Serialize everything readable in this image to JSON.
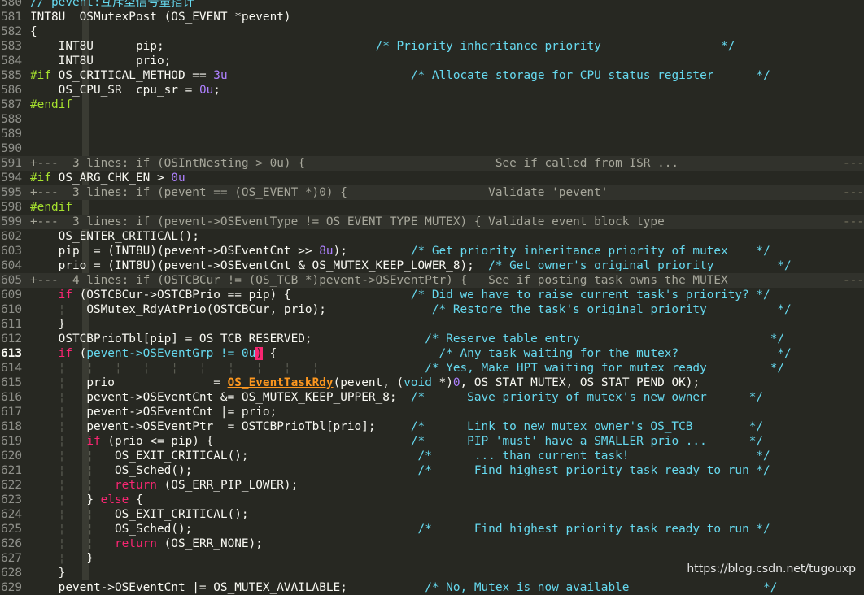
{
  "editor": {
    "lines": [
      {
        "n": "580",
        "parts": [
          {
            "t": "// pevent:互斥型信号量指针",
            "c": "cm"
          }
        ]
      },
      {
        "n": "581",
        "parts": [
          {
            "t": "INT8U  OSMutexPost (OS_EVENT *pevent)"
          }
        ]
      },
      {
        "n": "582",
        "parts": [
          {
            "t": "{"
          }
        ]
      },
      {
        "n": "583",
        "parts": [
          {
            "t": "    INT8U      pip;                              "
          },
          {
            "t": "/* Priority inheritance priority                 */",
            "c": "cm"
          }
        ]
      },
      {
        "n": "584",
        "parts": [
          {
            "t": "    INT8U      prio;"
          }
        ]
      },
      {
        "n": "585",
        "parts": [
          {
            "t": "#if",
            "c": "pp"
          },
          {
            "t": " OS_CRITICAL_METHOD == "
          },
          {
            "t": "3u",
            "c": "num"
          },
          {
            "t": "                          "
          },
          {
            "t": "/* Allocate storage for CPU status register      */",
            "c": "cm"
          }
        ]
      },
      {
        "n": "586",
        "parts": [
          {
            "t": "    OS_CPU_SR  cpu_sr = "
          },
          {
            "t": "0u",
            "c": "num"
          },
          {
            "t": ";"
          }
        ]
      },
      {
        "n": "587",
        "parts": [
          {
            "t": "#endif",
            "c": "pp"
          }
        ]
      },
      {
        "n": "588",
        "parts": []
      },
      {
        "n": "589",
        "parts": []
      },
      {
        "n": "590",
        "parts": []
      },
      {
        "n": "591",
        "fold": true,
        "parts": [
          {
            "t": "+---  3 lines: if (OSIntNesting > 0u) {                           See if called from ISR ..."
          }
        ]
      },
      {
        "n": "594",
        "parts": [
          {
            "t": "#if",
            "c": "pp"
          },
          {
            "t": " OS_ARG_CHK_EN > "
          },
          {
            "t": "0u",
            "c": "num"
          }
        ]
      },
      {
        "n": "595",
        "fold": true,
        "parts": [
          {
            "t": "+---  3 lines: if (pevent == (OS_EVENT *)0) {                    Validate 'pevent'"
          }
        ]
      },
      {
        "n": "598",
        "parts": [
          {
            "t": "#endif",
            "c": "pp"
          }
        ]
      },
      {
        "n": "599",
        "fold": true,
        "parts": [
          {
            "t": "+---  3 lines: if (pevent->OSEventType != OS_EVENT_TYPE_MUTEX) { Validate event block type"
          }
        ]
      },
      {
        "n": "602",
        "parts": [
          {
            "t": "    OS_ENTER_CRITICAL();"
          }
        ]
      },
      {
        "n": "603",
        "parts": [
          {
            "t": "    pip  = (INT8U)(pevent->OSEventCnt >> "
          },
          {
            "t": "8u",
            "c": "num"
          },
          {
            "t": ");         "
          },
          {
            "t": "/* Get priority inheritance priority of mutex    */",
            "c": "cm"
          }
        ]
      },
      {
        "n": "604",
        "parts": [
          {
            "t": "    prio = (INT8U)(pevent->OSEventCnt & OS_MUTEX_KEEP_LOWER_8);  "
          },
          {
            "t": "/* Get owner's original priority         */",
            "c": "cm"
          }
        ]
      },
      {
        "n": "605",
        "fold": true,
        "parts": [
          {
            "t": "+---  4 lines: if (OSTCBCur != (OS_TCB *)pevent->OSEventPtr) {   See if posting task owns the MUTEX"
          }
        ]
      },
      {
        "n": "609",
        "parts": [
          {
            "t": "    "
          },
          {
            "t": "if",
            "c": "kw"
          },
          {
            "t": " (OSTCBCur->OSTCBPrio == pip) {                 "
          },
          {
            "t": "/* Did we have to raise current task's priority? */",
            "c": "cm"
          }
        ]
      },
      {
        "n": "610",
        "parts": [
          {
            "t": "    "
          },
          {
            "t": "¦",
            "c": "guide"
          },
          {
            "t": "   OSMutex_RdyAtPrio(OSTCBCur, prio);               "
          },
          {
            "t": "/* Restore the task's original priority          */",
            "c": "cm"
          }
        ]
      },
      {
        "n": "611",
        "parts": [
          {
            "t": "    }"
          }
        ]
      },
      {
        "n": "612",
        "parts": [
          {
            "t": "    OSTCBPrioTbl[pip] = OS_TCB_RESERVED;                "
          },
          {
            "t": "/* Reserve table entry                           */",
            "c": "cm"
          }
        ]
      },
      {
        "n": "613",
        "cur": true,
        "parts": [
          {
            "t": "    "
          },
          {
            "t": "if",
            "c": "kw"
          },
          {
            "t": " ("
          },
          {
            "t": "pevent->OSEventGrp != 0u",
            "c": "hl"
          },
          {
            "t": ")",
            "c": "br"
          },
          {
            "t": " {                       "
          },
          {
            "t": "/* Any task waiting for the mutex?              */",
            "c": "cm"
          }
        ]
      },
      {
        "n": "614",
        "parts": [
          {
            "t": "    "
          },
          {
            "t": "¦   ¦   ¦   ¦   ¦   ¦   ¦   ¦   ¦   ¦",
            "c": "guide"
          },
          {
            "t": "               "
          },
          {
            "t": "/* Yes, Make HPT waiting for mutex ready         */",
            "c": "cm"
          }
        ]
      },
      {
        "n": "615",
        "parts": [
          {
            "t": "    "
          },
          {
            "t": "¦",
            "c": "guide"
          },
          {
            "t": "   prio              = "
          },
          {
            "t": "OS_EventTaskRdy",
            "c": "fn"
          },
          {
            "t": "(pevent, ("
          },
          {
            "t": "void",
            "c": "cm"
          },
          {
            "t": " *)"
          },
          {
            "t": "0",
            "c": "num"
          },
          {
            "t": ", OS_STAT_MUTEX, OS_STAT_PEND_OK);"
          }
        ]
      },
      {
        "n": "616",
        "parts": [
          {
            "t": "    "
          },
          {
            "t": "¦",
            "c": "guide"
          },
          {
            "t": "   pevent->OSEventCnt &= OS_MUTEX_KEEP_UPPER_8;  "
          },
          {
            "t": "/*      Save priority of mutex's new owner      */",
            "c": "cm"
          }
        ]
      },
      {
        "n": "617",
        "parts": [
          {
            "t": "    "
          },
          {
            "t": "¦",
            "c": "guide"
          },
          {
            "t": "   pevent->OSEventCnt |= prio;"
          }
        ]
      },
      {
        "n": "618",
        "parts": [
          {
            "t": "    "
          },
          {
            "t": "¦",
            "c": "guide"
          },
          {
            "t": "   pevent->OSEventPtr  = OSTCBPrioTbl[prio];     "
          },
          {
            "t": "/*      Link to new mutex owner's OS_TCB        */",
            "c": "cm"
          }
        ]
      },
      {
        "n": "619",
        "parts": [
          {
            "t": "    "
          },
          {
            "t": "¦",
            "c": "guide"
          },
          {
            "t": "   "
          },
          {
            "t": "if",
            "c": "kw"
          },
          {
            "t": " (prio <= pip) {                            "
          },
          {
            "t": "/*      PIP 'must' have a SMALLER prio ...      */",
            "c": "cm"
          }
        ]
      },
      {
        "n": "620",
        "parts": [
          {
            "t": "    "
          },
          {
            "t": "¦   ¦",
            "c": "guide"
          },
          {
            "t": "   OS_EXIT_CRITICAL();                        "
          },
          {
            "t": "/*      ... than current task!                  */",
            "c": "cm"
          }
        ]
      },
      {
        "n": "621",
        "parts": [
          {
            "t": "    "
          },
          {
            "t": "¦   ¦",
            "c": "guide"
          },
          {
            "t": "   OS_Sched();                                "
          },
          {
            "t": "/*      Find highest priority task ready to run */",
            "c": "cm"
          }
        ]
      },
      {
        "n": "622",
        "parts": [
          {
            "t": "    "
          },
          {
            "t": "¦   ¦",
            "c": "guide"
          },
          {
            "t": "   "
          },
          {
            "t": "return",
            "c": "kw"
          },
          {
            "t": " (OS_ERR_PIP_LOWER);"
          }
        ]
      },
      {
        "n": "623",
        "parts": [
          {
            "t": "    "
          },
          {
            "t": "¦",
            "c": "guide"
          },
          {
            "t": "   } "
          },
          {
            "t": "else",
            "c": "kw"
          },
          {
            "t": " {"
          }
        ]
      },
      {
        "n": "624",
        "parts": [
          {
            "t": "    "
          },
          {
            "t": "¦   ¦",
            "c": "guide"
          },
          {
            "t": "   OS_EXIT_CRITICAL();"
          }
        ]
      },
      {
        "n": "625",
        "parts": [
          {
            "t": "    "
          },
          {
            "t": "¦   ¦",
            "c": "guide"
          },
          {
            "t": "   OS_Sched();                                "
          },
          {
            "t": "/*      Find highest priority task ready to run */",
            "c": "cm"
          }
        ]
      },
      {
        "n": "626",
        "parts": [
          {
            "t": "    "
          },
          {
            "t": "¦   ¦",
            "c": "guide"
          },
          {
            "t": "   "
          },
          {
            "t": "return",
            "c": "kw"
          },
          {
            "t": " (OS_ERR_NONE);"
          }
        ]
      },
      {
        "n": "627",
        "parts": [
          {
            "t": "    "
          },
          {
            "t": "¦",
            "c": "guide"
          },
          {
            "t": "   }"
          }
        ]
      },
      {
        "n": "628",
        "parts": [
          {
            "t": "    }"
          }
        ]
      },
      {
        "n": "629",
        "parts": [
          {
            "t": "    pevent->OSEventCnt |= OS_MUTEX_AVAILABLE;           "
          },
          {
            "t": "/* No, Mutex is now available                   */",
            "c": "cm"
          }
        ]
      }
    ],
    "fold_dashes": "---"
  },
  "watermark": "https://blog.csdn.net/tugouxp"
}
